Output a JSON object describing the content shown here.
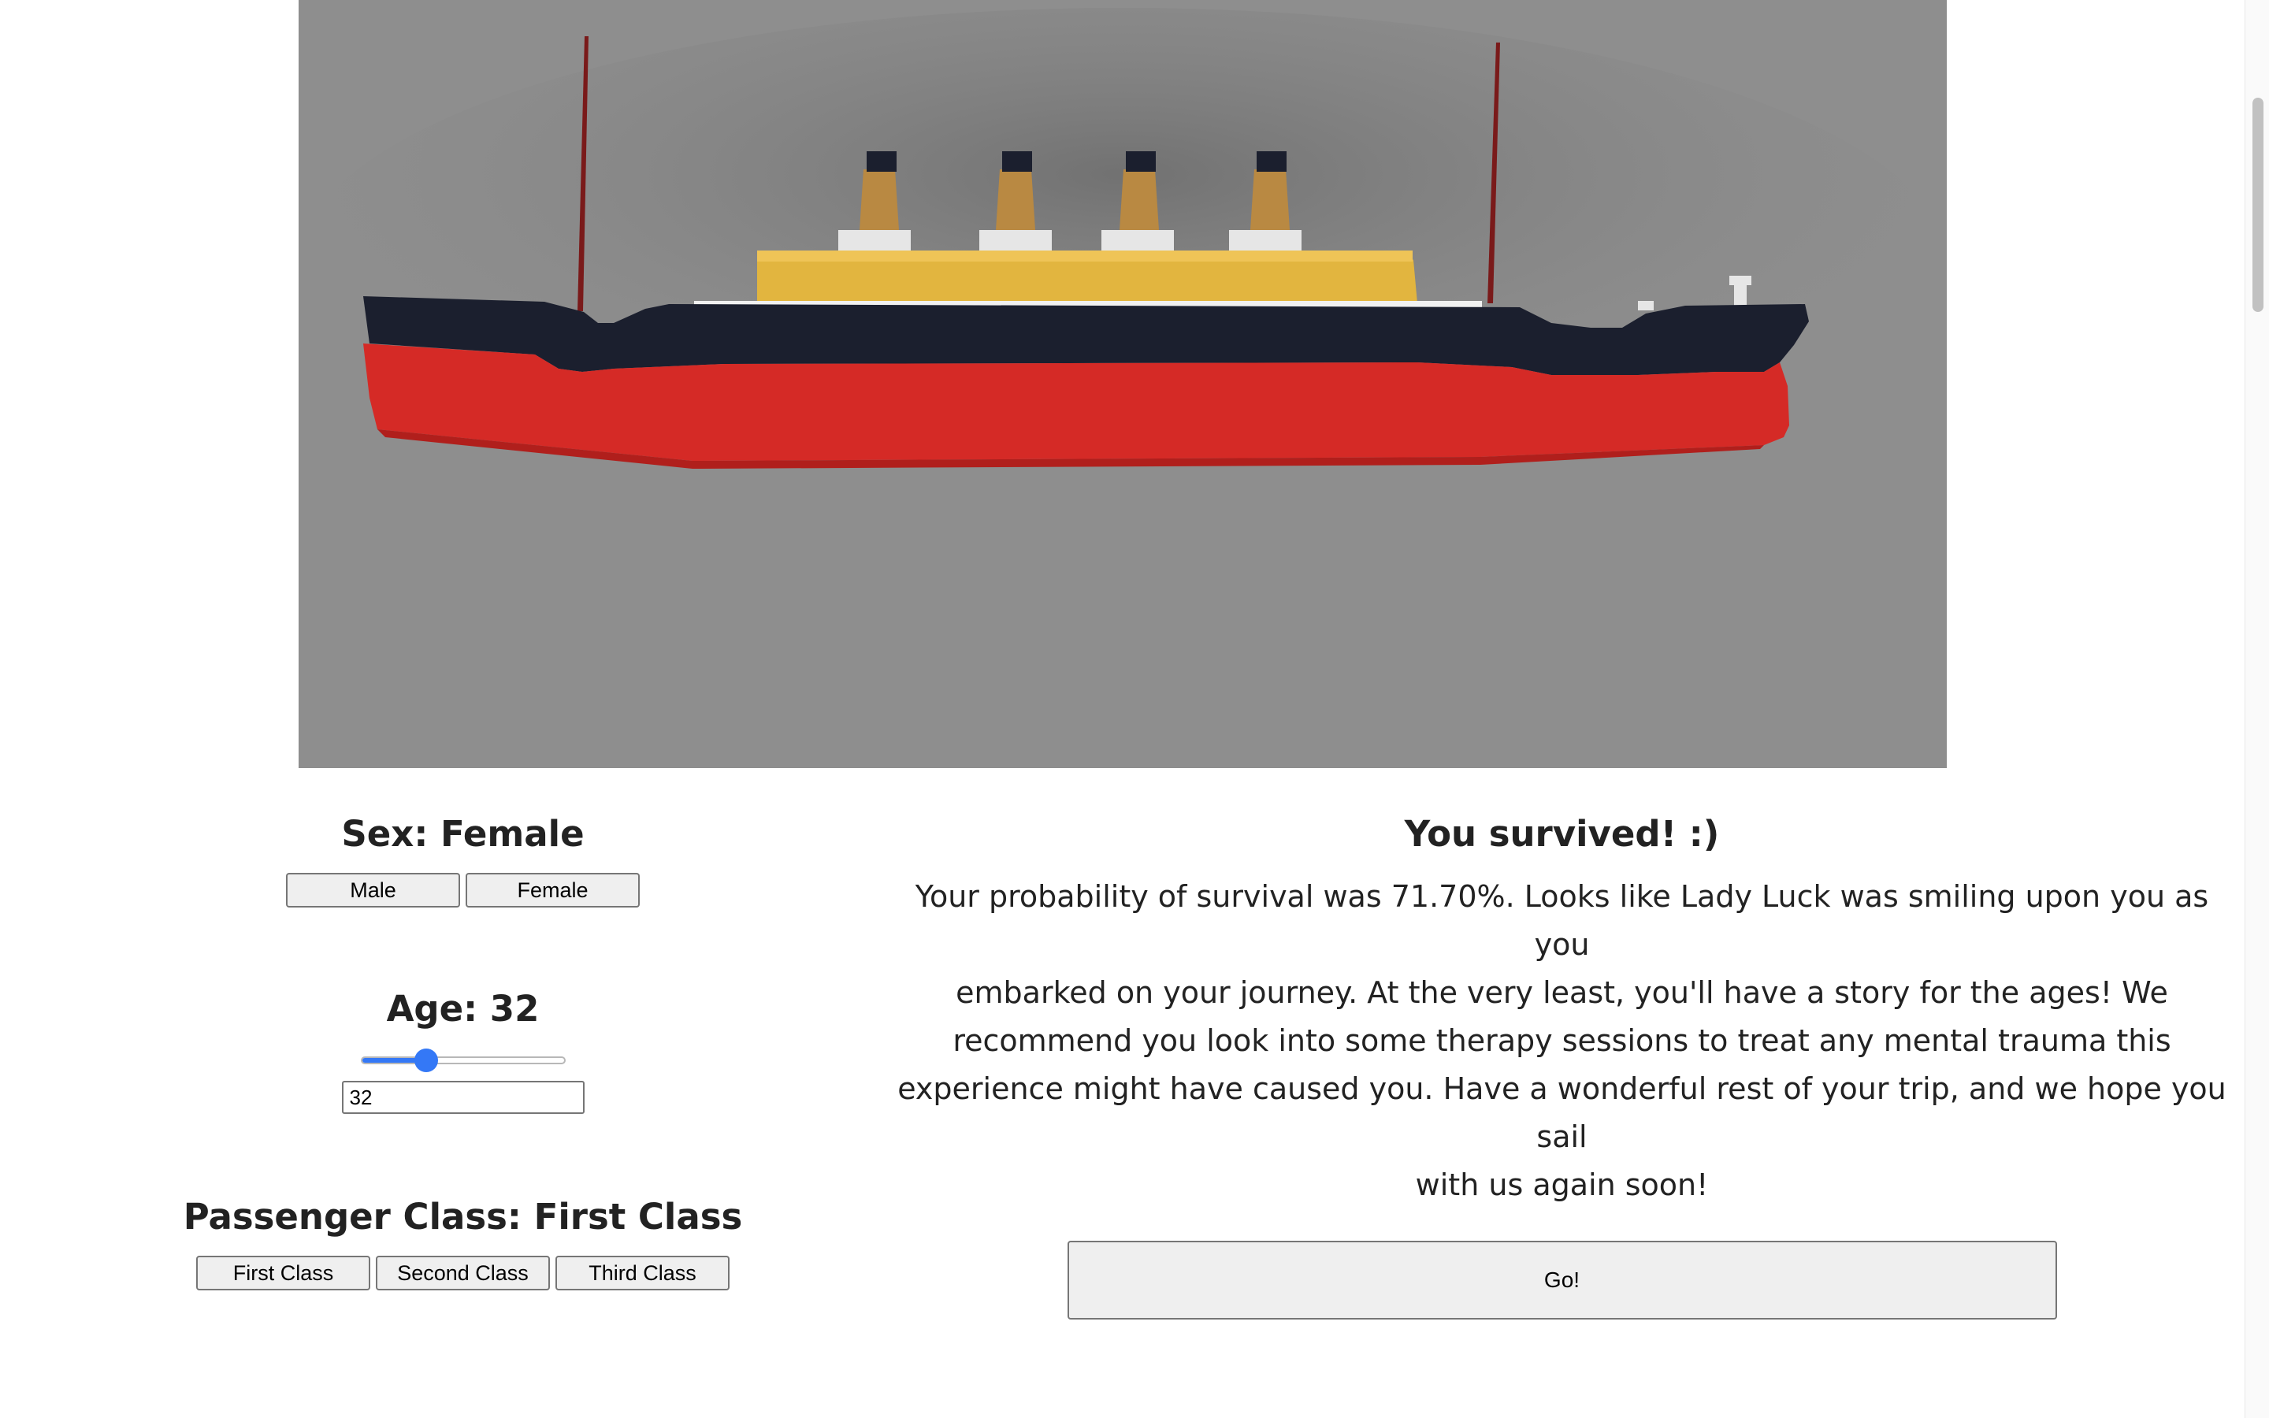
{
  "ship_scene": {
    "description_icon": "ship-icon",
    "background_color": "#8e8e8e",
    "hull_color": "#d52a26",
    "deck_color": "#1b1f2e",
    "superstructure_color": "#e2b53f",
    "funnel_color": "#b98942"
  },
  "sex": {
    "heading": "Sex: Female",
    "options": [
      "Male",
      "Female"
    ],
    "selected": "Female"
  },
  "age": {
    "heading": "Age: 32",
    "value": "32",
    "slider_value": 32,
    "slider_min": 0,
    "slider_max": 100,
    "accent_color": "#3478f6"
  },
  "passenger_class": {
    "heading": "Passenger Class: First Class",
    "options": [
      "First Class",
      "Second Class",
      "Third Class"
    ],
    "selected": "First Class"
  },
  "result": {
    "title": "You survived! :)",
    "lines": [
      "Your probability of survival was 71.70%. Looks like Lady Luck was smiling upon you as you",
      "embarked on your journey. At the very least, you'll have a story for the ages! We",
      "recommend you look into some therapy sessions to treat any mental trauma this",
      "experience might have caused you. Have a wonderful rest of your trip, and we hope you sail",
      "with us again soon!"
    ],
    "go_label": "Go!"
  }
}
